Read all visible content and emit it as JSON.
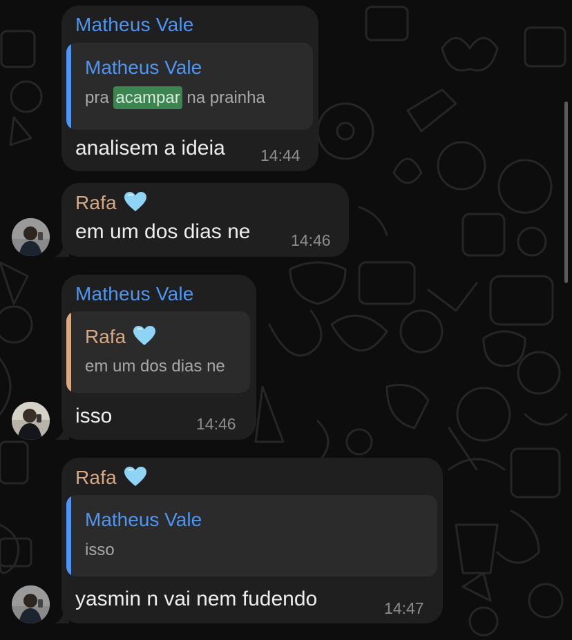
{
  "colors": {
    "background": "#0d0d0d",
    "bubble": "#1f1f1f",
    "quote": "#2b2b2b",
    "sender_blue": "#4f95f2",
    "sender_rafa": "#d9a984",
    "highlight": "#3d8550",
    "text": "#ededed",
    "time": "#8d8d8d"
  },
  "messages": [
    {
      "sender": "Matheus Vale",
      "quote": {
        "name": "Matheus Vale",
        "text_before": "pra ",
        "highlight": "acampar",
        "text_after": " na prainha"
      },
      "text": "analisem a ideia",
      "time": "14:44"
    },
    {
      "sender": "Rafa",
      "sender_emoji": "light-blue-heart-icon",
      "text": "em um dos dias ne",
      "time": "14:46"
    },
    {
      "sender": "Matheus Vale",
      "quote": {
        "name": "Rafa",
        "name_emoji": "light-blue-heart-icon",
        "text": "em um dos dias ne"
      },
      "text": "isso",
      "time": "14:46"
    },
    {
      "sender": "Rafa",
      "sender_emoji": "light-blue-heart-icon",
      "quote": {
        "name": "Matheus Vale",
        "text": "isso"
      },
      "text": "yasmin n vai nem fudendo",
      "time": "14:47"
    }
  ]
}
